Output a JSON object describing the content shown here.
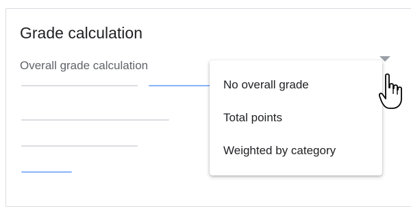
{
  "card": {
    "title": "Grade calculation",
    "label": "Overall grade calculation"
  },
  "menu": {
    "items": [
      {
        "label": "No overall grade"
      },
      {
        "label": "Total points"
      },
      {
        "label": "Weighted by category"
      }
    ]
  },
  "icons": {
    "dropdown": "chevron-down-icon",
    "cursor": "hand-pointer-cursor-icon"
  },
  "colors": {
    "accent": "#8ab4f8",
    "placeholder_line": "#dadce0",
    "text": "#202124",
    "secondary_text": "#5f6368"
  }
}
